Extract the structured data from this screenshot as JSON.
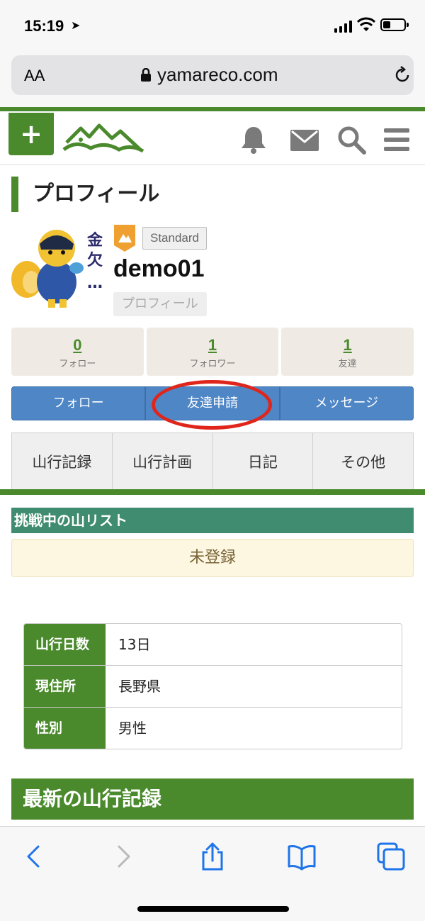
{
  "status_bar": {
    "time": "15:19"
  },
  "browser": {
    "text_size": "AA",
    "url": "yamareco.com"
  },
  "profile": {
    "heading": "プロフィール",
    "plan": "Standard",
    "username": "demo01",
    "profile_link": "プロフィール",
    "avatar_text": "金欠…"
  },
  "stats": [
    {
      "value": "0",
      "label": "フォロー"
    },
    {
      "value": "1",
      "label": "フォロワー"
    },
    {
      "value": "1",
      "label": "友達"
    }
  ],
  "actions": {
    "follow": "フォロー",
    "friend_request": "友達申請",
    "message": "メッセージ"
  },
  "tabs": [
    "山行記録",
    "山行計画",
    "日記",
    "その他"
  ],
  "challenge": {
    "heading": "挑戦中の山リスト",
    "empty_text": "未登録"
  },
  "info": [
    {
      "key": "山行日数",
      "value": "13日"
    },
    {
      "key": "現住所",
      "value": "長野県"
    },
    {
      "key": "性別",
      "value": "男性"
    }
  ],
  "latest": {
    "heading": "最新の山行記録"
  },
  "colors": {
    "brand_green": "#4a8a2c",
    "action_blue": "#4f86c6",
    "teal": "#3f8c70",
    "annotation_red": "#e0251b"
  }
}
